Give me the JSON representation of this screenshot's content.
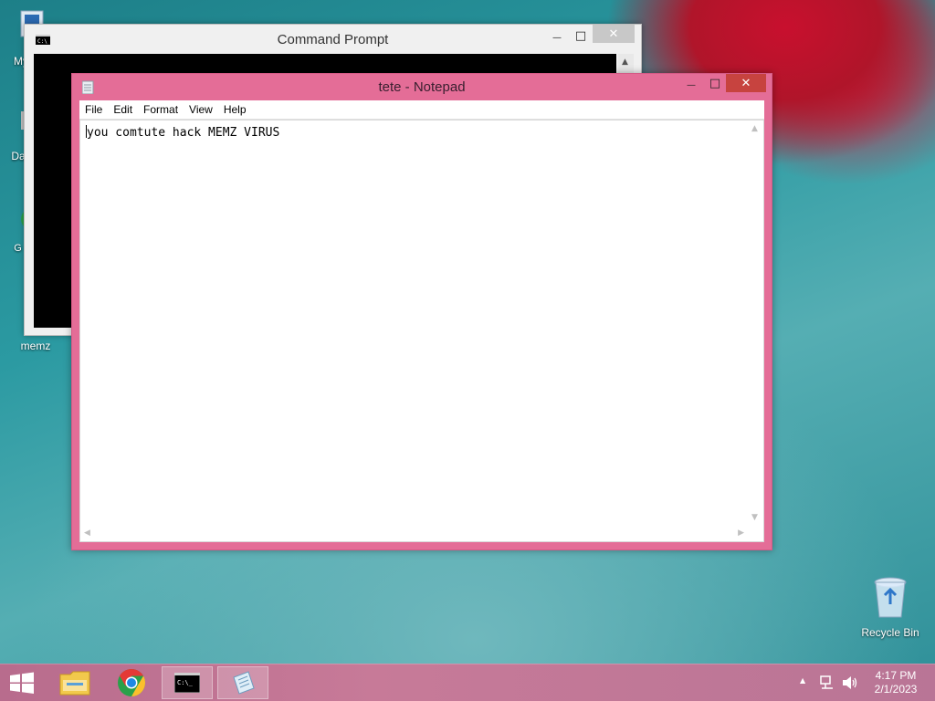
{
  "desktop": {
    "icons": [
      {
        "label": "My C"
      },
      {
        "label": "Data"
      },
      {
        "label": "G C"
      },
      {
        "label": "memz"
      },
      {
        "label": "Recycle Bin"
      }
    ]
  },
  "cmd_window": {
    "title": "Command Prompt",
    "icon": "cmd-icon"
  },
  "notepad": {
    "title": "tete - Notepad",
    "menu": [
      "File",
      "Edit",
      "Format",
      "View",
      "Help"
    ],
    "content": "you comtute hack MEMZ VIRUS"
  },
  "window_controls": {
    "minimize": "—",
    "maximize": "□",
    "close": "✕"
  },
  "taskbar": {
    "items": [
      "start-button",
      "file-explorer",
      "chrome",
      "command-prompt",
      "notepad"
    ],
    "tray": {
      "time": "4:17 PM",
      "date": "2/1/2023",
      "overflow": "▲"
    }
  },
  "colors": {
    "notepad_frame": "#e46d97",
    "taskbar": "#c77a98",
    "close_button": "#c7433f"
  }
}
